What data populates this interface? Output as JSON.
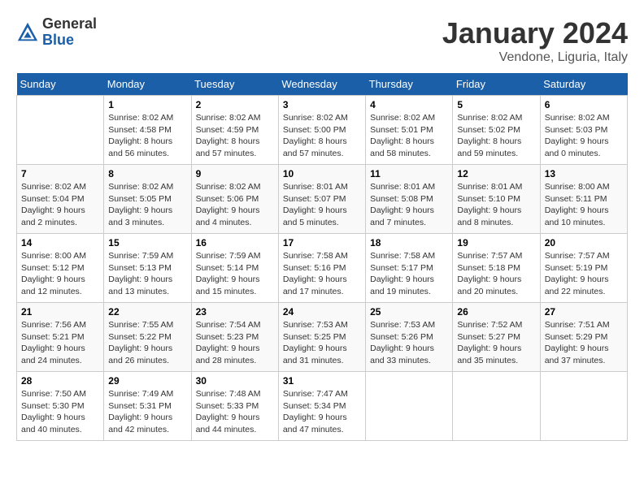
{
  "header": {
    "logo_general": "General",
    "logo_blue": "Blue",
    "month_title": "January 2024",
    "location": "Vendone, Liguria, Italy"
  },
  "days_of_week": [
    "Sunday",
    "Monday",
    "Tuesday",
    "Wednesday",
    "Thursday",
    "Friday",
    "Saturday"
  ],
  "weeks": [
    [
      {
        "day": "",
        "text": ""
      },
      {
        "day": "1",
        "text": "Sunrise: 8:02 AM\nSunset: 4:58 PM\nDaylight: 8 hours\nand 56 minutes."
      },
      {
        "day": "2",
        "text": "Sunrise: 8:02 AM\nSunset: 4:59 PM\nDaylight: 8 hours\nand 57 minutes."
      },
      {
        "day": "3",
        "text": "Sunrise: 8:02 AM\nSunset: 5:00 PM\nDaylight: 8 hours\nand 57 minutes."
      },
      {
        "day": "4",
        "text": "Sunrise: 8:02 AM\nSunset: 5:01 PM\nDaylight: 8 hours\nand 58 minutes."
      },
      {
        "day": "5",
        "text": "Sunrise: 8:02 AM\nSunset: 5:02 PM\nDaylight: 8 hours\nand 59 minutes."
      },
      {
        "day": "6",
        "text": "Sunrise: 8:02 AM\nSunset: 5:03 PM\nDaylight: 9 hours\nand 0 minutes."
      }
    ],
    [
      {
        "day": "7",
        "text": "Sunrise: 8:02 AM\nSunset: 5:04 PM\nDaylight: 9 hours\nand 2 minutes."
      },
      {
        "day": "8",
        "text": "Sunrise: 8:02 AM\nSunset: 5:05 PM\nDaylight: 9 hours\nand 3 minutes."
      },
      {
        "day": "9",
        "text": "Sunrise: 8:02 AM\nSunset: 5:06 PM\nDaylight: 9 hours\nand 4 minutes."
      },
      {
        "day": "10",
        "text": "Sunrise: 8:01 AM\nSunset: 5:07 PM\nDaylight: 9 hours\nand 5 minutes."
      },
      {
        "day": "11",
        "text": "Sunrise: 8:01 AM\nSunset: 5:08 PM\nDaylight: 9 hours\nand 7 minutes."
      },
      {
        "day": "12",
        "text": "Sunrise: 8:01 AM\nSunset: 5:10 PM\nDaylight: 9 hours\nand 8 minutes."
      },
      {
        "day": "13",
        "text": "Sunrise: 8:00 AM\nSunset: 5:11 PM\nDaylight: 9 hours\nand 10 minutes."
      }
    ],
    [
      {
        "day": "14",
        "text": "Sunrise: 8:00 AM\nSunset: 5:12 PM\nDaylight: 9 hours\nand 12 minutes."
      },
      {
        "day": "15",
        "text": "Sunrise: 7:59 AM\nSunset: 5:13 PM\nDaylight: 9 hours\nand 13 minutes."
      },
      {
        "day": "16",
        "text": "Sunrise: 7:59 AM\nSunset: 5:14 PM\nDaylight: 9 hours\nand 15 minutes."
      },
      {
        "day": "17",
        "text": "Sunrise: 7:58 AM\nSunset: 5:16 PM\nDaylight: 9 hours\nand 17 minutes."
      },
      {
        "day": "18",
        "text": "Sunrise: 7:58 AM\nSunset: 5:17 PM\nDaylight: 9 hours\nand 19 minutes."
      },
      {
        "day": "19",
        "text": "Sunrise: 7:57 AM\nSunset: 5:18 PM\nDaylight: 9 hours\nand 20 minutes."
      },
      {
        "day": "20",
        "text": "Sunrise: 7:57 AM\nSunset: 5:19 PM\nDaylight: 9 hours\nand 22 minutes."
      }
    ],
    [
      {
        "day": "21",
        "text": "Sunrise: 7:56 AM\nSunset: 5:21 PM\nDaylight: 9 hours\nand 24 minutes."
      },
      {
        "day": "22",
        "text": "Sunrise: 7:55 AM\nSunset: 5:22 PM\nDaylight: 9 hours\nand 26 minutes."
      },
      {
        "day": "23",
        "text": "Sunrise: 7:54 AM\nSunset: 5:23 PM\nDaylight: 9 hours\nand 28 minutes."
      },
      {
        "day": "24",
        "text": "Sunrise: 7:53 AM\nSunset: 5:25 PM\nDaylight: 9 hours\nand 31 minutes."
      },
      {
        "day": "25",
        "text": "Sunrise: 7:53 AM\nSunset: 5:26 PM\nDaylight: 9 hours\nand 33 minutes."
      },
      {
        "day": "26",
        "text": "Sunrise: 7:52 AM\nSunset: 5:27 PM\nDaylight: 9 hours\nand 35 minutes."
      },
      {
        "day": "27",
        "text": "Sunrise: 7:51 AM\nSunset: 5:29 PM\nDaylight: 9 hours\nand 37 minutes."
      }
    ],
    [
      {
        "day": "28",
        "text": "Sunrise: 7:50 AM\nSunset: 5:30 PM\nDaylight: 9 hours\nand 40 minutes."
      },
      {
        "day": "29",
        "text": "Sunrise: 7:49 AM\nSunset: 5:31 PM\nDaylight: 9 hours\nand 42 minutes."
      },
      {
        "day": "30",
        "text": "Sunrise: 7:48 AM\nSunset: 5:33 PM\nDaylight: 9 hours\nand 44 minutes."
      },
      {
        "day": "31",
        "text": "Sunrise: 7:47 AM\nSunset: 5:34 PM\nDaylight: 9 hours\nand 47 minutes."
      },
      {
        "day": "",
        "text": ""
      },
      {
        "day": "",
        "text": ""
      },
      {
        "day": "",
        "text": ""
      }
    ]
  ]
}
